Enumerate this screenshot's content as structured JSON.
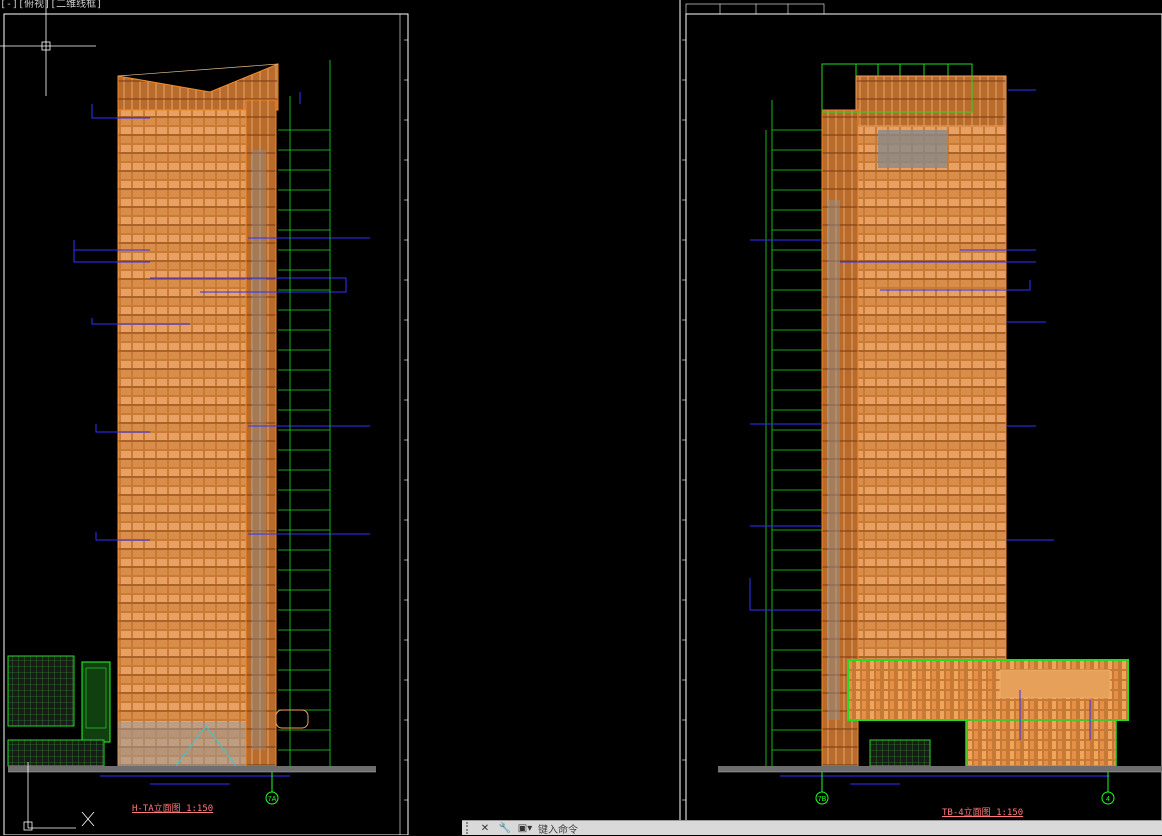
{
  "viewport": {
    "header": "[-][俯视][二维线框]"
  },
  "left_drawing": {
    "title": "H-TA立面图 1:150"
  },
  "right_drawing": {
    "title": "TB-4立面图 1:150"
  },
  "axis_bubbles": [
    "7A",
    "7B",
    "4"
  ],
  "command_bar": {
    "close_icon": "close-icon",
    "customize_icon": "wrench-icon",
    "prompt_icon": "command-prompt-icon",
    "input_placeholder": "键入命令"
  },
  "colors": {
    "background": "#000000",
    "facade": "#d88a3f",
    "grid_lines": "#00ff00",
    "dimension_lines": "#3030ff",
    "text_red": "#ff5a5a",
    "border_white": "#ffffff"
  }
}
